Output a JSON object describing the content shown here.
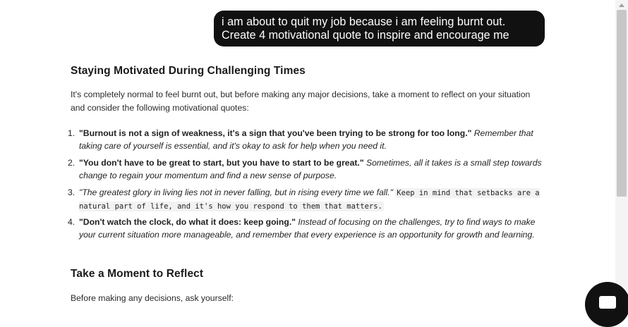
{
  "user_message": {
    "lines": [
      "i am about to quit my job because i am feeling burnt out.",
      "Create 4 motivational quote to inspire and encourage me"
    ]
  },
  "response": {
    "heading": "Staying Motivated During Challenging Times",
    "intro": "It's completely normal to feel burnt out, but before making any major decisions, take a moment to reflect on your situation and consider the following motivational quotes:",
    "quotes": [
      {
        "number": "1.",
        "quote": "\"Burnout is not a sign of weakness, it's a sign that you've been trying to be strong for too long.\"",
        "commentary": "Remember that taking care of yourself is essential, and it's okay to ask for help when you need it."
      },
      {
        "number": "2.",
        "quote": "\"You don't have to be great to start, but you have to start to be great.\"",
        "commentary": "Sometimes, all it takes is a small step towards change to regain your momentum and find a new sense of purpose."
      },
      {
        "number": "3.",
        "quote": "\"The greatest glory in living lies not in never falling, but in rising every time we fall.\"",
        "commentary": "Keep in mind that setbacks are a natural part of life, and it's how you respond to them that matters."
      },
      {
        "number": "4.",
        "quote": "\"Don't watch the clock, do what it does: keep going.\"",
        "commentary": "Instead of focusing on the challenges, try to find ways to make your current situation more manageable, and remember that every experience is an opportunity for growth and learning."
      }
    ],
    "heading2": "Take a Moment to Reflect",
    "reflect_intro": "Before making any decisions, ask yourself:"
  },
  "icons": {
    "fab": "chat-icon"
  }
}
